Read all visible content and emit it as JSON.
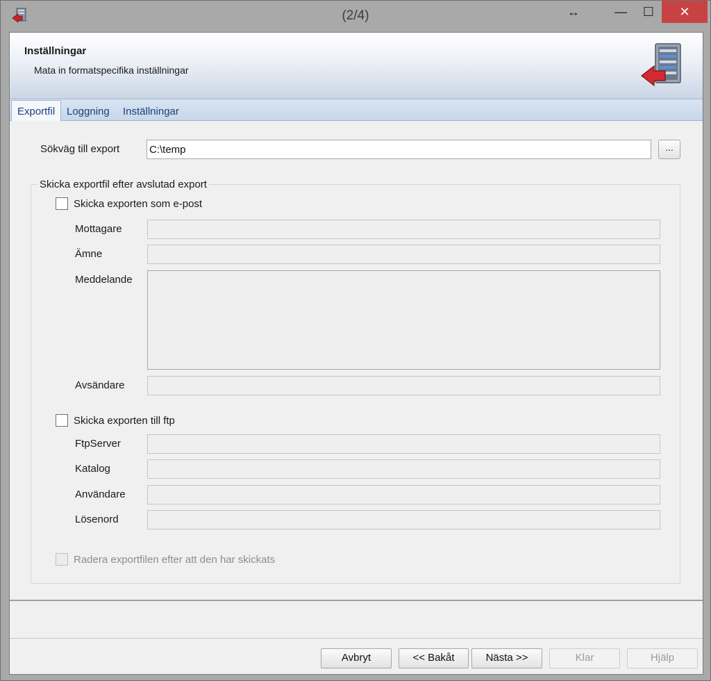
{
  "window": {
    "title": "(2/4)",
    "resize_glyph": "↔",
    "minimize_glyph": "—",
    "maximize_glyph": "☐",
    "close_glyph": "✕"
  },
  "header": {
    "title": "Inställningar",
    "subtitle": "Mata in formatspecifika inställningar",
    "icon": "server-export-icon"
  },
  "tabs": [
    {
      "label": "Exportfil",
      "active": true
    },
    {
      "label": "Loggning",
      "active": false
    },
    {
      "label": "Inställningar",
      "active": false
    }
  ],
  "export_path": {
    "label": "Sökväg till export",
    "value": "C:\\temp",
    "browse_label": "..."
  },
  "send_group": {
    "title": "Skicka exportfil efter avslutad export",
    "email": {
      "checkbox_label": "Skicka exporten som e-post",
      "checked": false,
      "recipient_label": "Mottagare",
      "subject_label": "Ämne",
      "message_label": "Meddelande",
      "sender_label": "Avsändare",
      "recipient_value": "",
      "subject_value": "",
      "sender_value": ""
    },
    "ftp": {
      "checkbox_label": "Skicka exporten till ftp",
      "checked": false,
      "server_label": "FtpServer",
      "directory_label": "Katalog",
      "user_label": "Användare",
      "password_label": "Lösenord",
      "server_value": "",
      "directory_value": "",
      "user_value": "",
      "password_value": ""
    },
    "delete_after": {
      "label": "Radera exportfilen efter att den har skickats",
      "checked": false,
      "enabled": false
    }
  },
  "buttons": {
    "cancel": "Avbryt",
    "back": "<< Bakåt",
    "next": "Nästa >>",
    "finish": "Klar",
    "help": "Hjälp"
  }
}
